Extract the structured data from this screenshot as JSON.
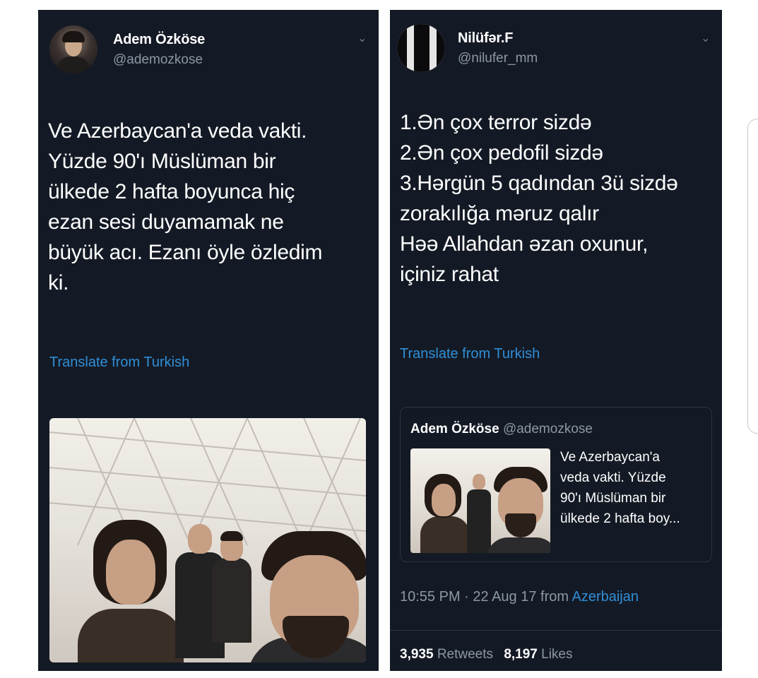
{
  "left_tweet": {
    "display_name": "Adem Özköse",
    "handle": "@ademozkose",
    "text": "Ve Azerbaycan'a veda vakti.\nYüzde 90'ı Müslüman bir\nülkede 2 hafta boyunca hiç\nezan sesi duyamamak ne\nbüyük acı. Ezanı öyle özledim\nki.",
    "translate_label": "Translate from Turkish",
    "menu_icon": "chevron-down-icon"
  },
  "right_tweet": {
    "display_name": "Nilüfər.F",
    "handle": "@nilufer_mm",
    "text": "1.Ən çox terror sizdə\n2.Ən çox pedofil sizdə\n3.Hərgün 5 qadından 3ü sizdə\nzorakılığa məruz qalır\nHəə Allahdan əzan oxunur,\niçiniz rahat",
    "translate_label": "Translate from Turkish",
    "menu_icon": "chevron-down-icon",
    "quoted": {
      "display_name": "Adem Özköse",
      "handle": "@ademozkose",
      "text": "Ve Azerbaycan'a\nveda vakti. Yüzde\n90'ı Müslüman bir\nülkede 2 hafta boy..."
    },
    "timestamp": "10:55 PM · 22 Aug 17 from",
    "location": "Azerbaijan",
    "retweets_count": "3,935",
    "retweets_label": "Retweets",
    "likes_count": "8,197",
    "likes_label": "Likes"
  },
  "colors": {
    "card_bg": "#141a25",
    "link": "#2f8fd8",
    "muted": "#8b98a5"
  }
}
